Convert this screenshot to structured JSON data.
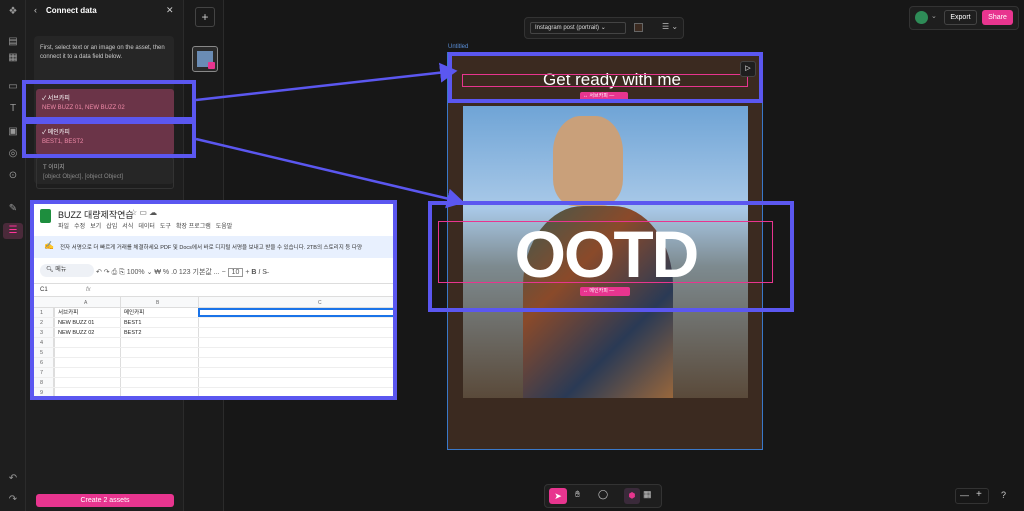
{
  "panel": {
    "title": "Connect data",
    "instructions": "First, select text or an image on the asset, then connect it to a data field below.",
    "fields": [
      {
        "name": "서브카피",
        "value": "NEW BUZZ 01, NEW BUZZ 02"
      },
      {
        "name": "메인카피",
        "value": "BEST1, BEST2"
      },
      {
        "name": "이미지",
        "value": "[object Object], [object Object]"
      }
    ],
    "create_button": "Create 2 assets"
  },
  "toolbar": {
    "format": "Instagram post (portrait)",
    "export": "Export",
    "share": "Share"
  },
  "canvas": {
    "frame_label": "Untitled",
    "headline": "Get ready with me",
    "main_text": "OOTD",
    "tag_sub": "↔ 서브카피",
    "tag_main": "↔ 메인카피",
    "tag_dash": "—"
  },
  "sheet": {
    "title": "BUZZ 대량제작연습",
    "menus": [
      "파일",
      "수정",
      "보기",
      "삽입",
      "서식",
      "데이터",
      "도구",
      "확장 프로그램",
      "도움말"
    ],
    "notice": "전자 서명으로 더 빠르게 거래를 체결하세요  PDF 및 Docs에서 바로 디지털 서명을 보내고 받을 수 있습니다. 2TB의 스토리지 등 다양",
    "search": "메뉴",
    "zoom": "100%",
    "font": "기본값 ...",
    "fontsize": "10",
    "cellref": "C1",
    "fx": "fx",
    "cols": [
      "A",
      "B",
      "C"
    ],
    "rows": [
      [
        "서브카피",
        "메인카피",
        ""
      ],
      [
        "NEW BUZZ 01",
        "BEST1",
        ""
      ],
      [
        "NEW BUZZ 02",
        "BEST2",
        ""
      ],
      [
        "",
        "",
        ""
      ],
      [
        "",
        "",
        ""
      ],
      [
        "",
        "",
        ""
      ],
      [
        "",
        "",
        ""
      ],
      [
        "",
        "",
        ""
      ],
      [
        "",
        "",
        ""
      ]
    ]
  },
  "bottom": {
    "minus": "—",
    "plus": "+",
    "help": "?"
  },
  "colors": {
    "accent": "#e8358f",
    "highlight": "#5b57f0",
    "frame_bg": "#3b2a20"
  }
}
